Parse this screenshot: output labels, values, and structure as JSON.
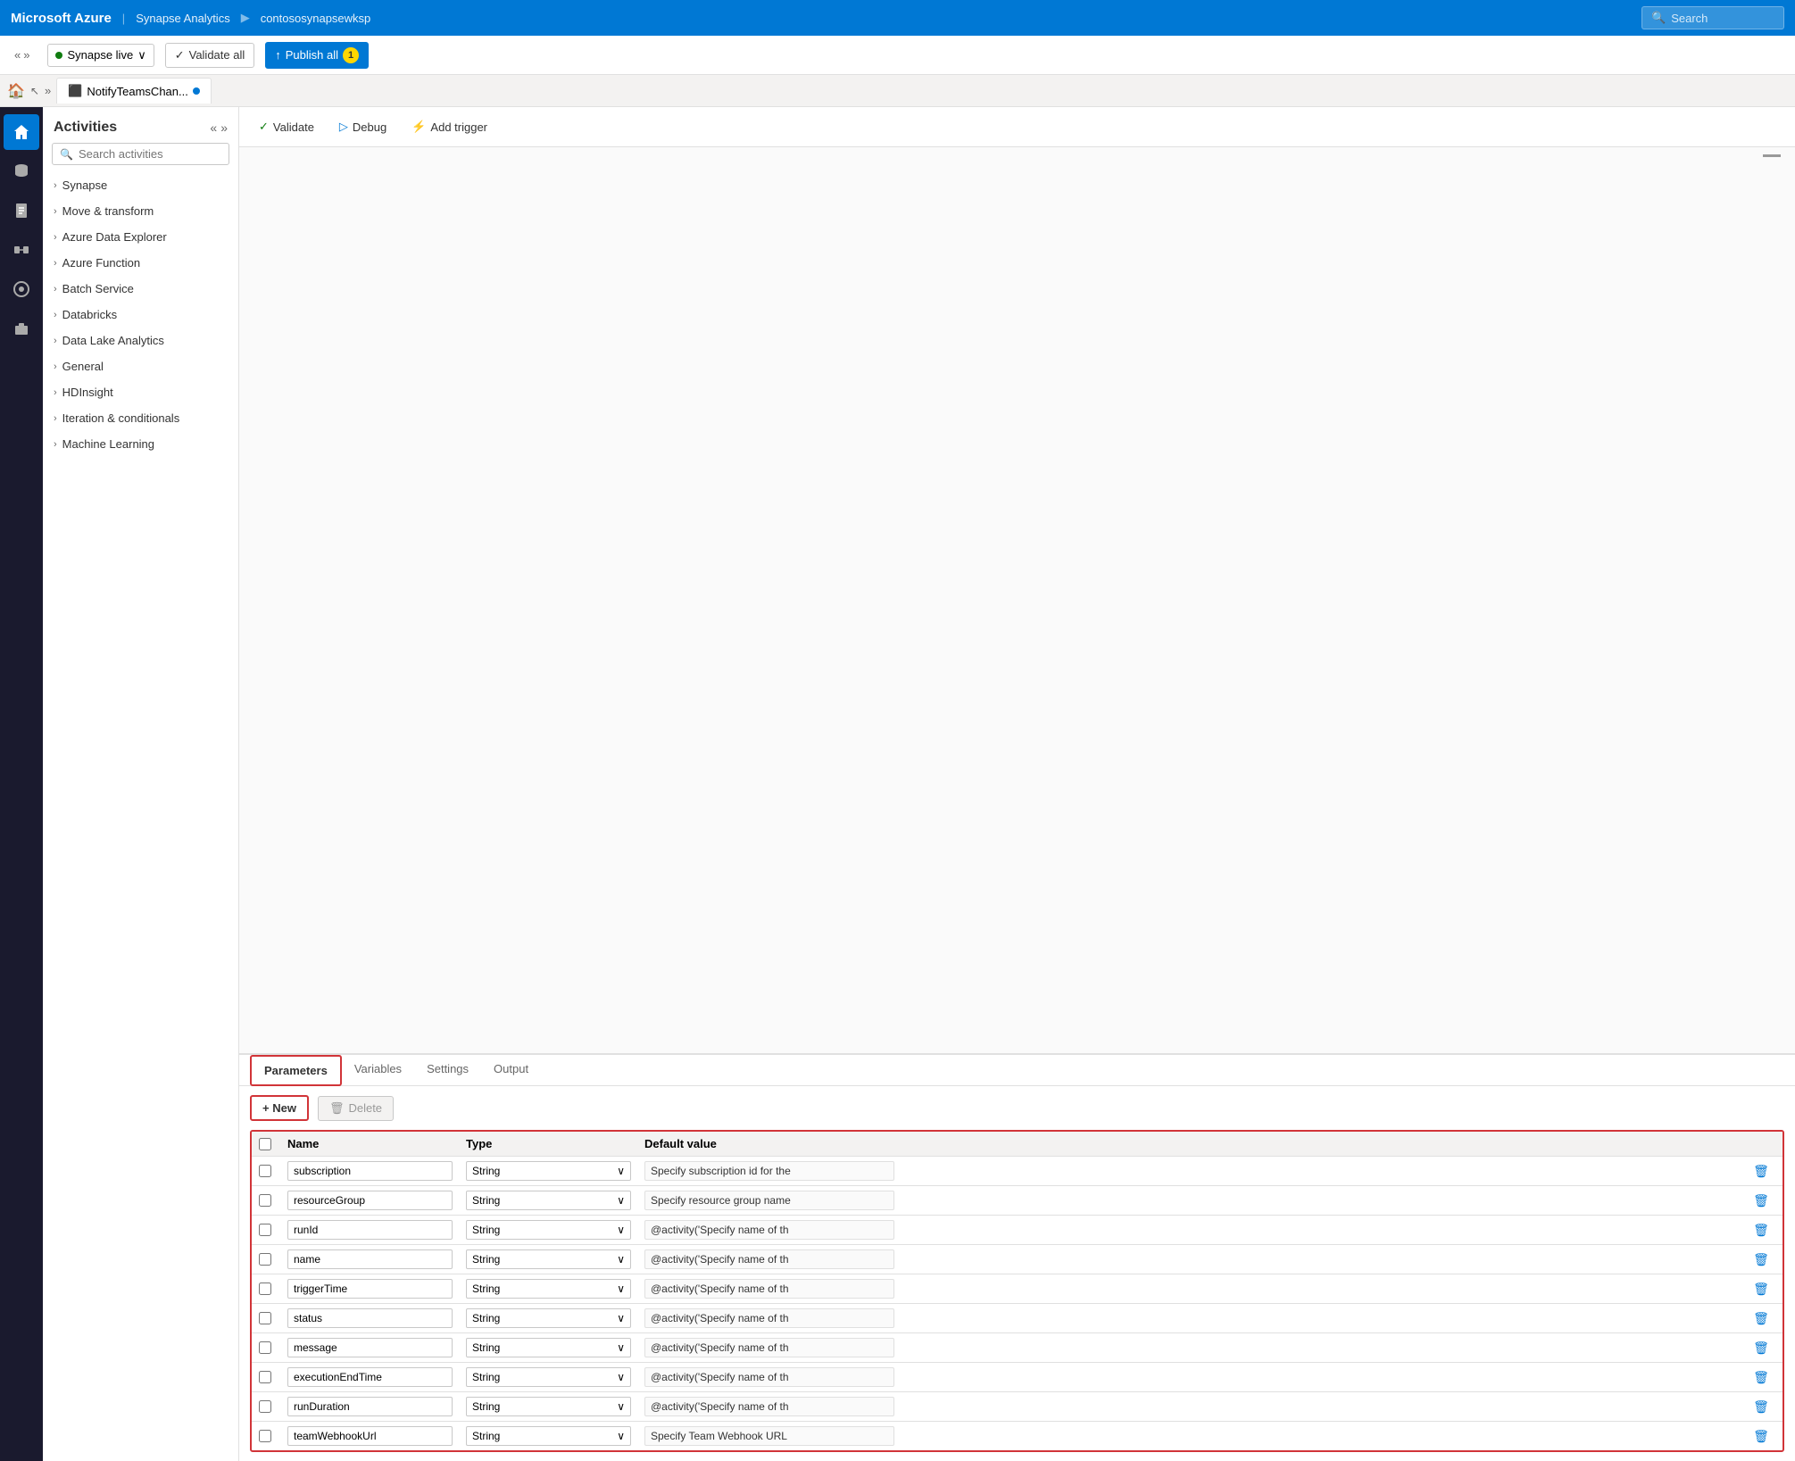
{
  "topbar": {
    "brand": "Microsoft Azure",
    "nav1": "Synapse Analytics",
    "nav2": "contososynapsewksp",
    "search_placeholder": "Search"
  },
  "toolbar": {
    "synapse_live": "Synapse live",
    "validate_all": "Validate all",
    "publish_all": "Publish all",
    "publish_badge": "1"
  },
  "tab": {
    "name": "NotifyTeamsChan...",
    "has_unsaved": true
  },
  "activities": {
    "title": "Activities",
    "search_placeholder": "Search activities",
    "groups": [
      {
        "name": "Synapse"
      },
      {
        "name": "Move & transform"
      },
      {
        "name": "Azure Data Explorer"
      },
      {
        "name": "Azure Function"
      },
      {
        "name": "Batch Service"
      },
      {
        "name": "Databricks"
      },
      {
        "name": "Data Lake Analytics"
      },
      {
        "name": "General"
      },
      {
        "name": "HDInsight"
      },
      {
        "name": "Iteration & conditionals"
      },
      {
        "name": "Machine Learning"
      }
    ]
  },
  "activity_toolbar": {
    "validate": "Validate",
    "debug": "Debug",
    "add_trigger": "Add trigger"
  },
  "panel_tabs": {
    "tabs": [
      "Parameters",
      "Variables",
      "Settings",
      "Output"
    ],
    "active": "Parameters"
  },
  "params": {
    "new_label": "+ New",
    "delete_label": "Delete",
    "columns": {
      "name": "Name",
      "type": "Type",
      "default": "Default value"
    },
    "rows": [
      {
        "name": "subscription",
        "type": "String",
        "default": "Specify subscription id for the"
      },
      {
        "name": "resourceGroup",
        "type": "String",
        "default": "Specify resource group name"
      },
      {
        "name": "runId",
        "type": "String",
        "default": "@activity('Specify name of th"
      },
      {
        "name": "name",
        "type": "String",
        "default": "@activity('Specify name of th"
      },
      {
        "name": "triggerTime",
        "type": "String",
        "default": "@activity('Specify name of th"
      },
      {
        "name": "status",
        "type": "String",
        "default": "@activity('Specify name of th"
      },
      {
        "name": "message",
        "type": "String",
        "default": "@activity('Specify name of th"
      },
      {
        "name": "executionEndTime",
        "type": "String",
        "default": "@activity('Specify name of th"
      },
      {
        "name": "runDuration",
        "type": "String",
        "default": "@activity('Specify name of th"
      },
      {
        "name": "teamWebhookUrl",
        "type": "String",
        "default": "Specify Team Webhook URL"
      }
    ]
  },
  "icons": {
    "home": "🏠",
    "database": "🗄",
    "doc": "📄",
    "pipeline": "▶",
    "settings": "⚙",
    "briefcase": "💼",
    "search": "🔍",
    "chevron_right": "›",
    "chevron_down": "∨",
    "validate_icon": "✓",
    "debug_icon": "▷",
    "trigger_icon": "⚡",
    "delete_icon": "🗑",
    "collapse": "«",
    "expand": "»"
  }
}
